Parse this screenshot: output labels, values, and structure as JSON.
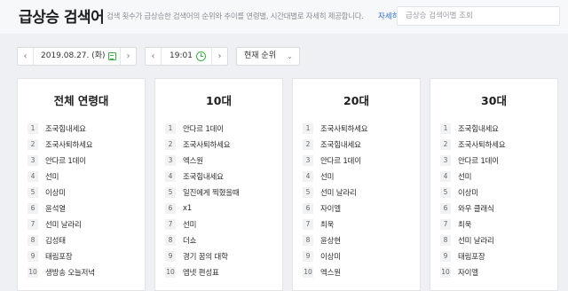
{
  "header": {
    "title": "급상승 검색어",
    "description": "검색 횟수가 급상승한 검색어의 순위와 추이를 연령별, 시간대별로 자세히 제공합니다.",
    "more_link": "자세히",
    "search_placeholder": "급상승 검색어별 조회"
  },
  "controls": {
    "date": "2019.08.27. (화)",
    "time": "19:01",
    "sort": "현재 순위",
    "icons": [
      "chevron-left-icon",
      "calendar-icon",
      "chevron-right-icon",
      "clock-icon",
      "chevron-down-icon"
    ]
  },
  "columns": [
    {
      "title": "전체 연령대",
      "items": [
        "조국힘내세요",
        "조국사퇴하세요",
        "안다르 1데이",
        "선미",
        "이상미",
        "윤석열",
        "선미 날라리",
        "김성태",
        "태림포장",
        "생방송 오늘저녁"
      ]
    },
    {
      "title": "10대",
      "items": [
        "안다르 1데이",
        "조국사퇴하세요",
        "엑스원",
        "조국힘내세요",
        "일진에게 찍혔을때",
        "x1",
        "선미",
        "더쇼",
        "경기 꿈의 대학",
        "엠넷 편성표"
      ]
    },
    {
      "title": "20대",
      "items": [
        "조국사퇴하세요",
        "조국힘내세요",
        "안다르 1데이",
        "선미",
        "선미 날라리",
        "자이엘",
        "최욱",
        "윤상현",
        "이상미",
        "엑스원"
      ]
    },
    {
      "title": "30대",
      "items": [
        "조국힘내세요",
        "조국사퇴하세요",
        "안다르 1데이",
        "선미",
        "이상미",
        "와우 클래식",
        "최욱",
        "선미 날라리",
        "태림포장",
        "자이엘"
      ]
    }
  ],
  "colors": {
    "accent_link": "#2f6fd6",
    "icon_green": "#3fae4a",
    "background": "#eef0f3"
  }
}
